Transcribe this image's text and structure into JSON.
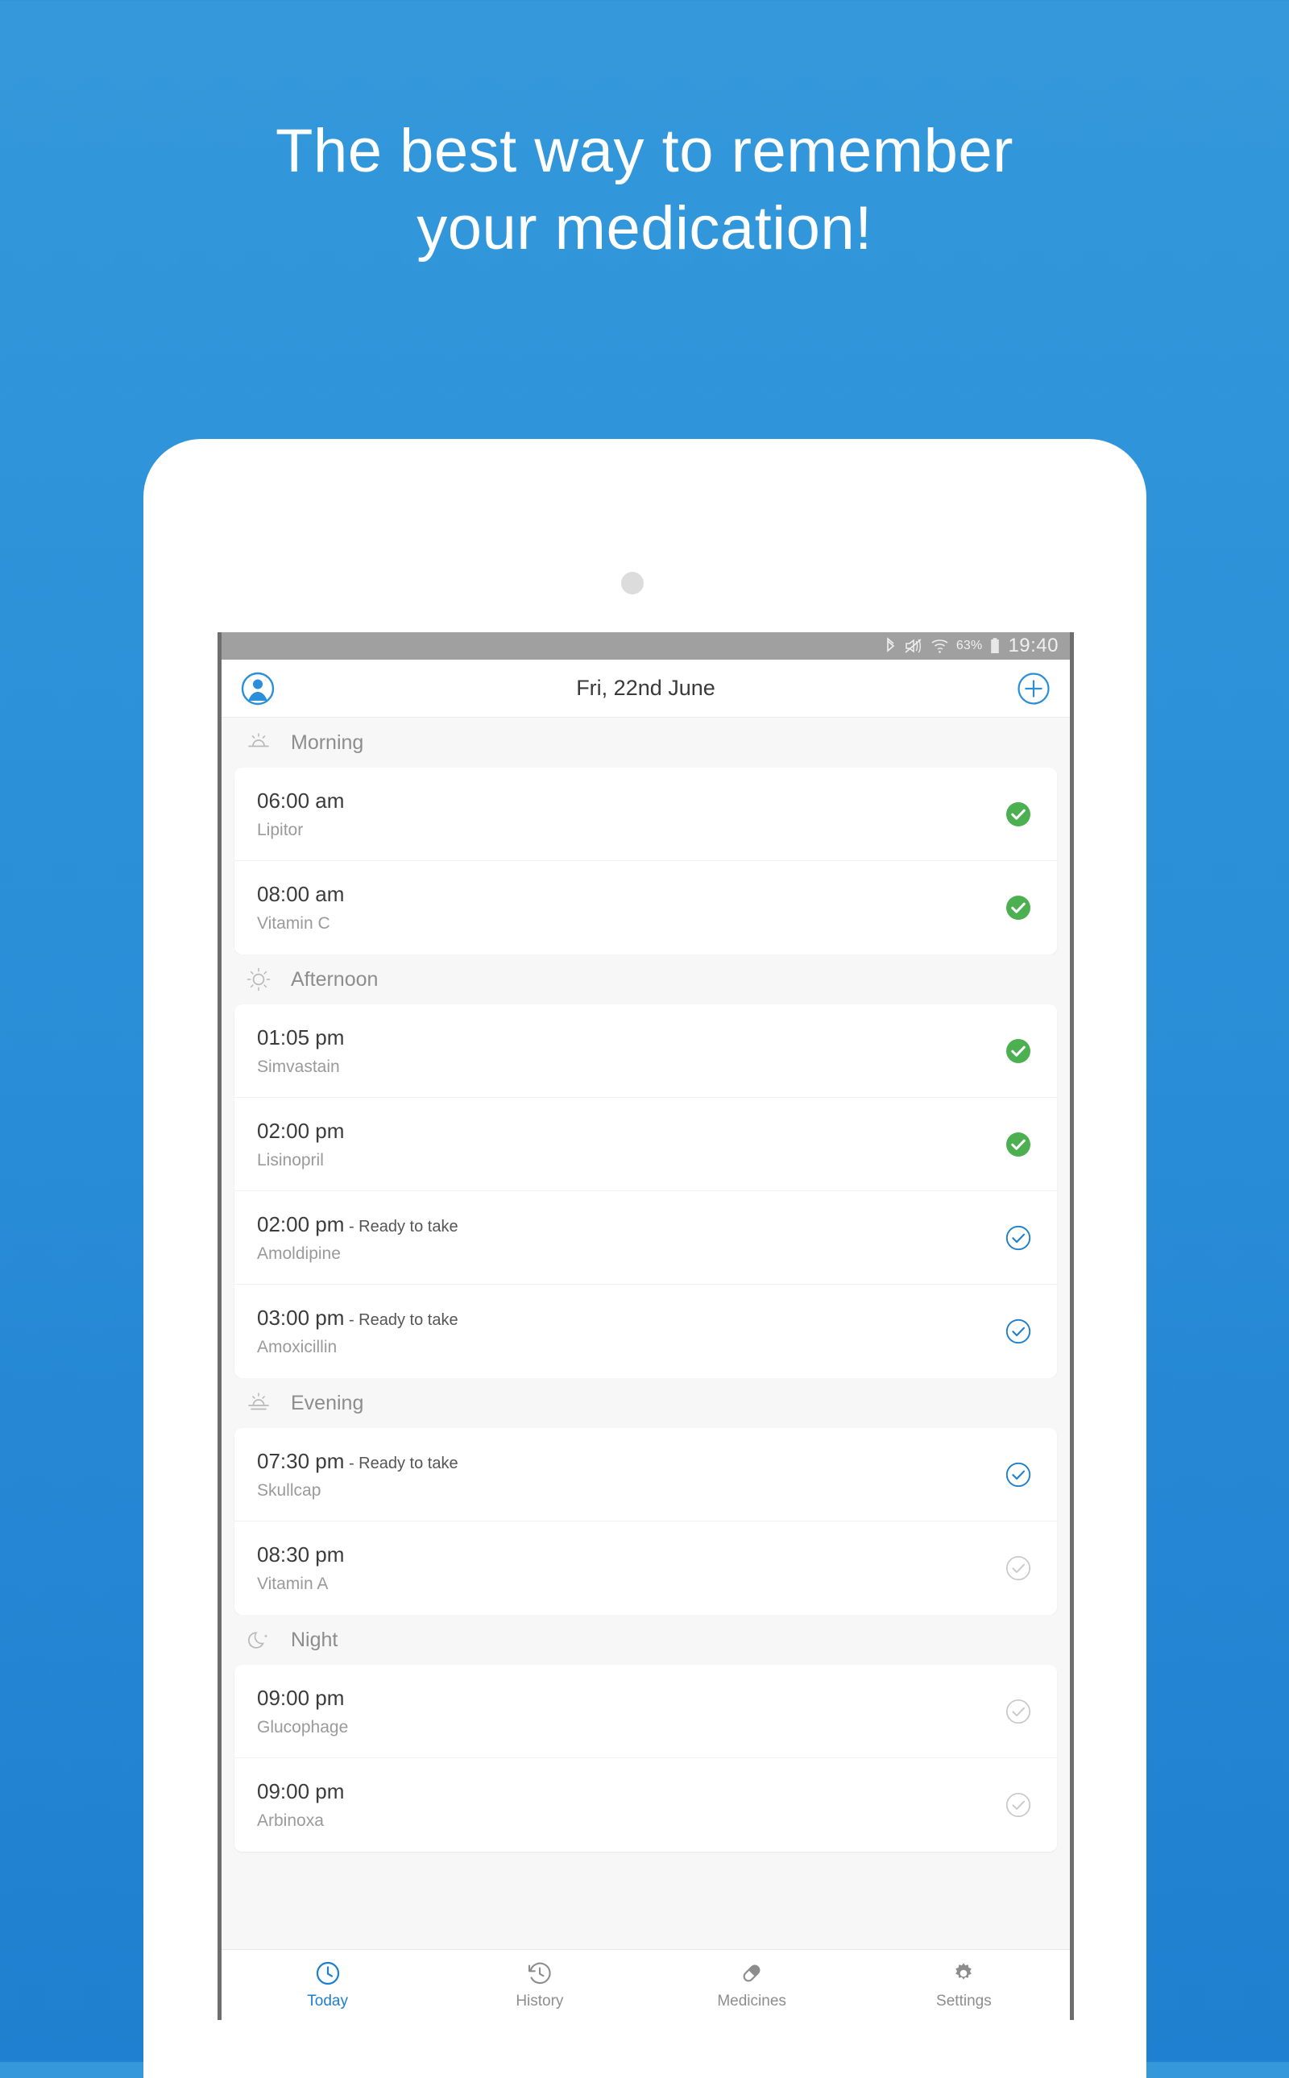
{
  "promo": {
    "line1": "The best way to remember",
    "line2": "your medication!"
  },
  "colors": {
    "background_top": "#3498db",
    "background_bottom": "#1f7fd0",
    "accent": "#1d7fd0",
    "taken_green": "#4CAF50",
    "pending_grey": "#c8c8c8"
  },
  "statusbar": {
    "battery": "63%",
    "time": "19:40",
    "icons": [
      "bluetooth-icon",
      "volume-mute-icon",
      "wifi-icon",
      "battery-icon"
    ]
  },
  "appbar": {
    "profile_icon": "profile-avatar-icon",
    "title": "Fri, 22nd June",
    "add_icon": "plus-circle-icon"
  },
  "sections": [
    {
      "label": "Morning",
      "icon": "sunrise-icon",
      "items": [
        {
          "time": "06:00 am",
          "status_suffix": "",
          "name": "Lipitor",
          "state": "taken"
        },
        {
          "time": "08:00 am",
          "status_suffix": "",
          "name": "Vitamin C",
          "state": "taken"
        }
      ]
    },
    {
      "label": "Afternoon",
      "icon": "sun-icon",
      "items": [
        {
          "time": "01:05 pm",
          "status_suffix": "",
          "name": "Simvastain",
          "state": "taken"
        },
        {
          "time": "02:00 pm",
          "status_suffix": "",
          "name": "Lisinopril",
          "state": "taken"
        },
        {
          "time": "02:00 pm",
          "status_suffix": " - Ready to take",
          "name": "Amoldipine",
          "state": "ready"
        },
        {
          "time": "03:00 pm",
          "status_suffix": " - Ready to take",
          "name": "Amoxicillin",
          "state": "ready"
        }
      ]
    },
    {
      "label": "Evening",
      "icon": "sunset-icon",
      "items": [
        {
          "time": "07:30 pm",
          "status_suffix": " - Ready to take",
          "name": "Skullcap",
          "state": "ready"
        },
        {
          "time": "08:30 pm",
          "status_suffix": "",
          "name": "Vitamin A",
          "state": "pending"
        }
      ]
    },
    {
      "label": "Night",
      "icon": "moon-icon",
      "items": [
        {
          "time": "09:00 pm",
          "status_suffix": "",
          "name": "Glucophage",
          "state": "pending"
        },
        {
          "time": "09:00 pm",
          "status_suffix": "",
          "name": "Arbinoxa",
          "state": "pending"
        }
      ]
    }
  ],
  "bottomnav": [
    {
      "label": "Today",
      "icon": "clock-icon",
      "active": true
    },
    {
      "label": "History",
      "icon": "history-icon",
      "active": false
    },
    {
      "label": "Medicines",
      "icon": "pill-icon",
      "active": false
    },
    {
      "label": "Settings",
      "icon": "gear-icon",
      "active": false
    }
  ]
}
